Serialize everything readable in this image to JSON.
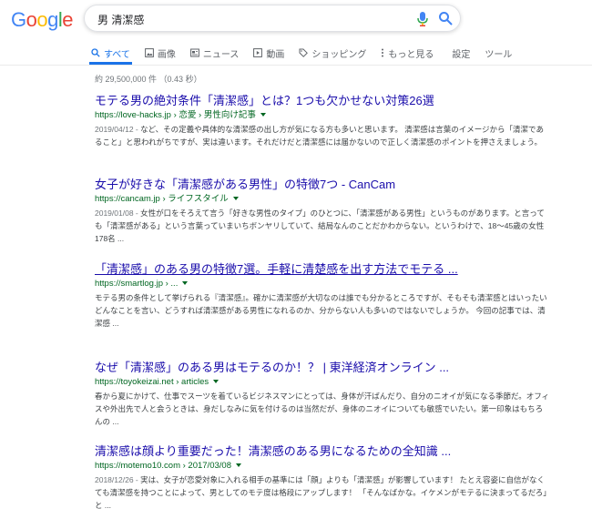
{
  "logo": {
    "text": "Google",
    "letters": [
      "G",
      "o",
      "o",
      "g",
      "l",
      "e"
    ],
    "colors": [
      "#4285F4",
      "#EA4335",
      "#FBBC05",
      "#4285F4",
      "#34A853",
      "#EA4335"
    ]
  },
  "search": {
    "query": "男 清潔感"
  },
  "tabs": [
    {
      "label": "すべて",
      "icon": "search-icon"
    },
    {
      "label": "画像",
      "icon": "image-icon"
    },
    {
      "label": "ニュース",
      "icon": "news-icon"
    },
    {
      "label": "動画",
      "icon": "video-icon"
    },
    {
      "label": "ショッピング",
      "icon": "tag-icon"
    },
    {
      "label": "もっと見る",
      "icon": "more-vert-icon"
    },
    {
      "label": "設定"
    },
    {
      "label": "ツール"
    }
  ],
  "stats": "約 29,500,000 件 （0.43 秒）",
  "results": [
    {
      "title": "モテる男の絶対条件「清潔感」とは？1つも欠かせない対策26選",
      "url": "https://love-hacks.jp › 恋愛 › 男性向け記事",
      "date": "2019/04/12 - ",
      "snippet": "など、その定義や具体的な清潔感の出し方が気になる方も多いと思います。 清潔感は言葉のイメージから「清潔であること」と思われがちですが、実は違います。それだけだと清潔感には届かないので正しく清潔感のポイントを押さえましょう。"
    },
    {
      "title": "女子が好きな「清潔感がある男性」の特徴7つ - CanCam",
      "url": "https://cancam.jp › ライフスタイル",
      "date": "2019/01/08 - ",
      "snippet": "女性が口をそろえて言う「好きな男性のタイプ」のひとつに、「清潔感がある男性」というものがあります。と言っても「清潔感がある」という言葉っていまいちボンヤリしていて、結局なんのことだかわからない。というわけで、18〜45歳の女性178名 ..."
    },
    {
      "title": "「清潔感」のある男の特徴7選。手軽に清楚感を出す方法でモテる ...",
      "url": "https://smartlog.jp › ...",
      "date": "",
      "snippet": "モテる男の条件として挙げられる『清潔感』。確かに清潔感が大切なのは誰でも分かるところですが、そもそも清潔感とはいったいどんなことを言い、どうすれば清潔感がある男性になれるのか、分からない人も多いのではないでしょうか。 今回の記事では、清潔感 ..."
    },
    {
      "title": "なぜ「清潔感」のある男はモテるのか！？ | 東洋経済オンライン ...",
      "url": "https://toyokeizai.net › articles",
      "date": "",
      "snippet": "春から夏にかけて、仕事でスーツを着ているビジネスマンにとっては、身体が汗ばんだり、自分のニオイが気になる季節だ。オフィスや外出先で人と会うときは、身だしなみに気を付けるのは当然だが、身体のニオイについても敏感でいたい。第一印象はもちろんの ..."
    },
    {
      "title": "清潔感は顔より重要だった！清潔感のある男になるための全知識 ...",
      "url": "https://motemo10.com › 2017/03/08",
      "date": "2018/12/26 - ",
      "snippet": "実は、女子が恋愛対象に入れる相手の基準には「顔」よりも「清潔感」が影響しています！ たとえ容姿に自信がなくても清潔感を持つことによって、男としてのモテ度は格段にアップします！ 「そんなばかな。イケメンがモテるに決まってるだろ」と ..."
    }
  ]
}
